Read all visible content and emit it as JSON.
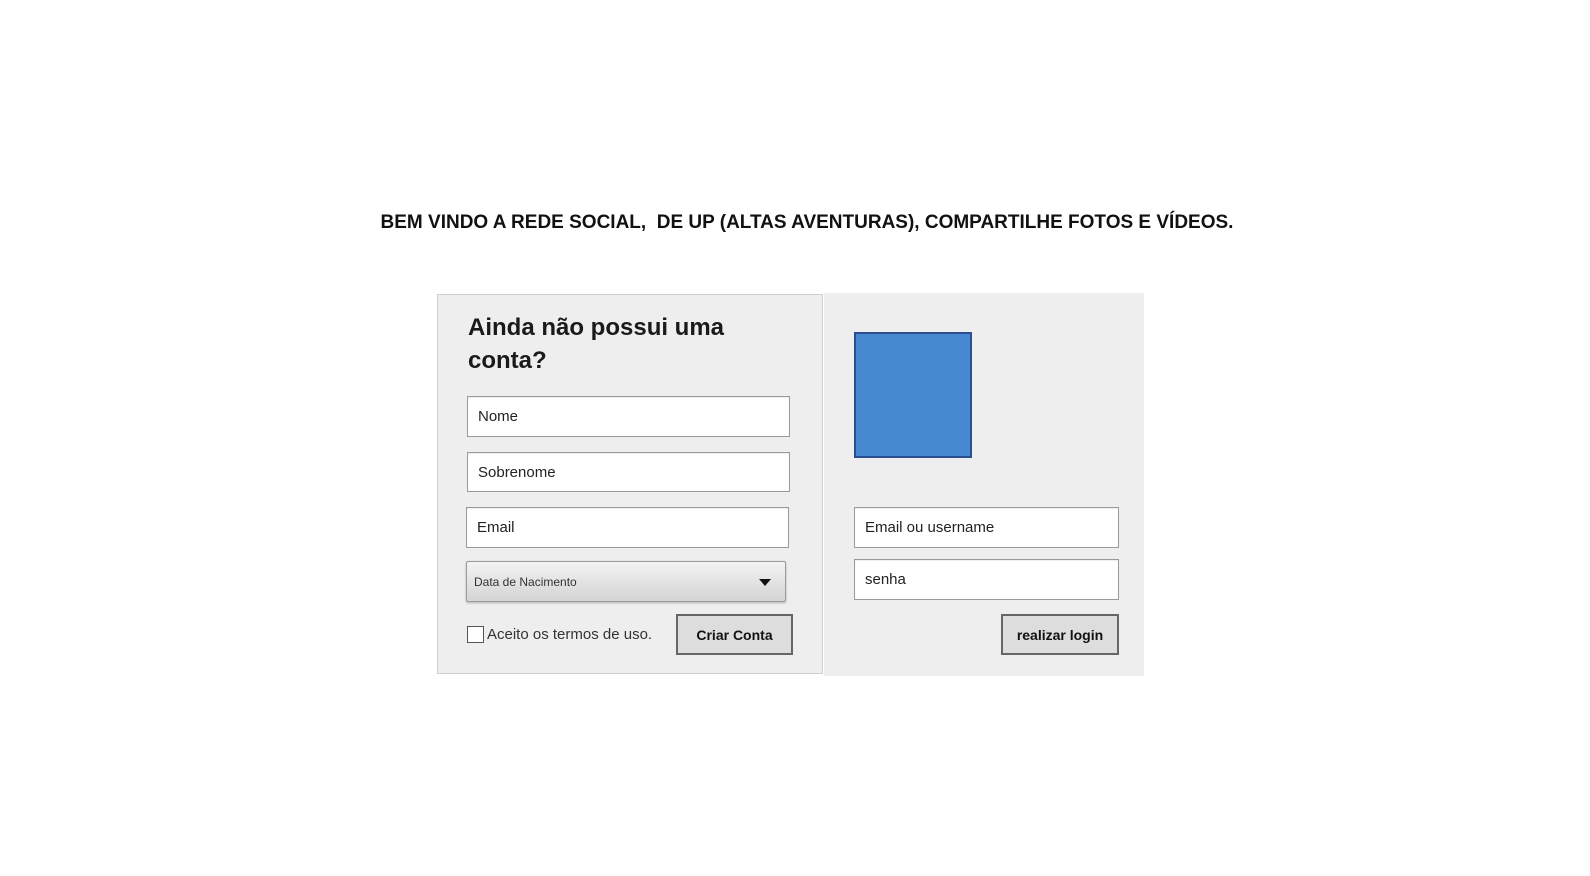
{
  "header": {
    "welcome_text": "BEM VINDO A REDE SOCIAL,  DE UP (ALTAS AVENTURAS), COMPARTILHE FOTOS E VÍDEOS."
  },
  "signup": {
    "title": "Ainda não possui uma conta?",
    "name_placeholder": "Nome",
    "surname_placeholder": "Sobrenome",
    "email_placeholder": "Email",
    "birthdate_select": "Data de Nacimento",
    "terms_label": "Aceito os termos de uso.",
    "terms_checked": false,
    "create_button": "Criar Conta"
  },
  "login": {
    "avatar_color": "#4689d0",
    "user_placeholder": "Email ou username",
    "password_placeholder": "senha",
    "login_button": "realizar login"
  },
  "colors": {
    "panel_bg": "#eeeeee",
    "button_bg": "#dddddd"
  }
}
